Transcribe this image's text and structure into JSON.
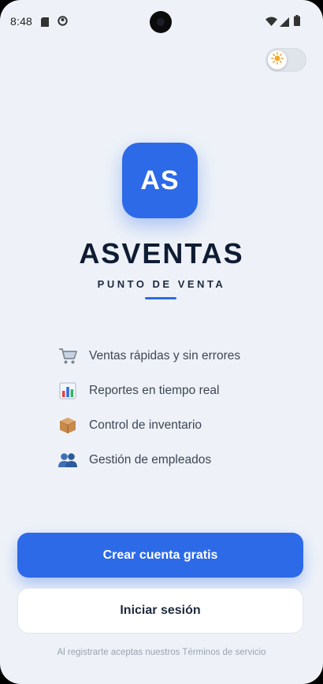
{
  "status_bar": {
    "time": "8:48",
    "icons": [
      "sd-card-icon",
      "notification-circle-icon",
      "wifi-icon",
      "signal-icon",
      "battery-icon"
    ]
  },
  "theme_toggle": {
    "icon": "sun-icon",
    "state": "light"
  },
  "brand": {
    "logo_text": "AS",
    "logo_color": "#2d6ae8",
    "title": "ASVENTAS",
    "subtitle": "PUNTO DE VENTA"
  },
  "features": [
    {
      "icon": "shopping-cart-icon",
      "label": "Ventas rápidas y sin errores"
    },
    {
      "icon": "bar-chart-icon",
      "label": "Reportes en tiempo real"
    },
    {
      "icon": "package-icon",
      "label": "Control de inventario"
    },
    {
      "icon": "people-icon",
      "label": "Gestión de empleados"
    }
  ],
  "actions": {
    "primary_label": "Crear cuenta gratis",
    "secondary_label": "Iniciar sesión"
  },
  "footer": {
    "terms_text": "Al registrarte aceptas nuestros Términos de servicio"
  },
  "colors": {
    "accent": "#2d6ae8",
    "background": "#eef2f8",
    "title": "#0f1c33"
  }
}
